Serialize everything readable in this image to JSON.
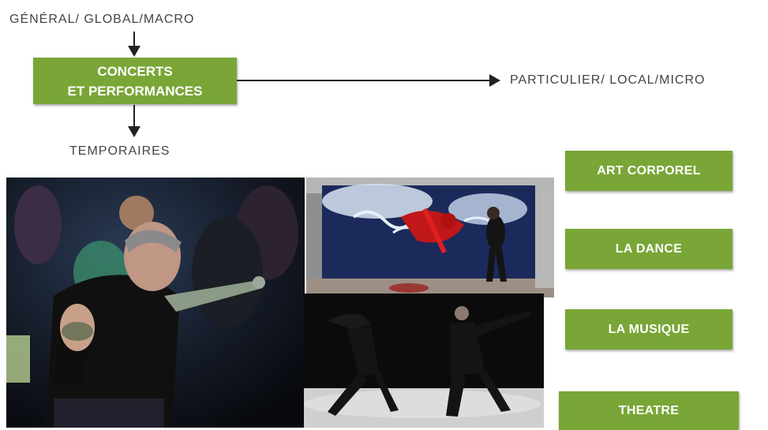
{
  "diagram": {
    "top_label": "GÉNÉRAL/ GLOBAL/MACRO",
    "center_box": {
      "line1": "CONCERTS",
      "line2": "ET PERFORMANCES"
    },
    "right_label": "PARTICULIER/ LOCAL/MICRO",
    "bottom_label": "TEMPORAIRES"
  },
  "categories": [
    {
      "label": "ART CORPOREL"
    },
    {
      "label": "LA DANCE"
    },
    {
      "label": "LA MUSIQUE"
    },
    {
      "label": "THEATRE"
    }
  ],
  "photos": [
    {
      "icon": "performer-photo"
    },
    {
      "icon": "action-painting-photo"
    },
    {
      "icon": "dancers-photo"
    }
  ],
  "colors": {
    "box_green": "#79a637",
    "text_gray": "#444444",
    "arrow": "#222222"
  }
}
